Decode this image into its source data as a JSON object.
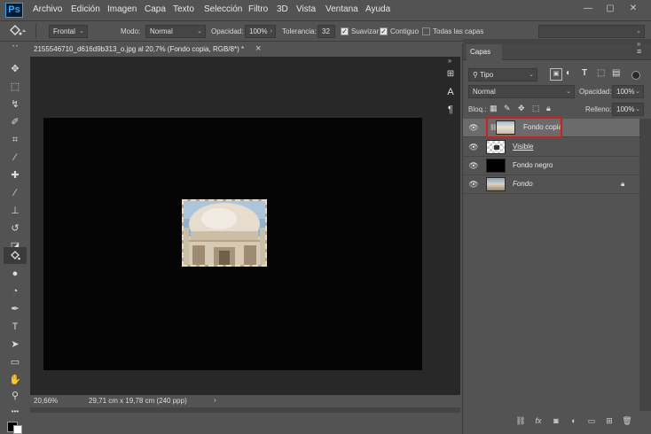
{
  "app": {
    "logo": "Ps"
  },
  "menu": [
    "Archivo",
    "Edición",
    "Imagen",
    "Capa",
    "Texto",
    "Selección",
    "Filtro",
    "3D",
    "Vista",
    "Ventana",
    "Ayuda"
  ],
  "window_controls": {
    "minimize": "—",
    "maximize": "▢",
    "close": "✕"
  },
  "options": {
    "preset": "Frontal",
    "mode_label": "Modo:",
    "mode_value": "Normal",
    "opacity_label": "Opacidad:",
    "opacity_value": "100%",
    "tolerance_label": "Tolerancia:",
    "tolerance_value": "32",
    "smooth_label": "Suavizar",
    "contiguous_label": "Contiguo",
    "all_layers_label": "Todas las capas"
  },
  "document": {
    "tab_title": "2155546710_d616d9b313_o.jpg al 20,7% (Fondo copia, RGB/8*) *",
    "close": "×",
    "zoom": "20,66%",
    "dimensions": "29,71 cm x 19,78 cm (240 ppp)"
  },
  "layers_panel": {
    "tab": "Capas",
    "filter_value": "Tipo",
    "blend_mode": "Normal",
    "opacity_label": "Opacidad:",
    "opacity_value": "100%",
    "lock_label": "Bloq.:",
    "fill_label": "Relleno:",
    "fill_value": "100%",
    "layers": [
      {
        "name": "Fondo copia"
      },
      {
        "name": "Visible"
      },
      {
        "name": "Fondo negro"
      },
      {
        "name": "Fondo"
      }
    ]
  },
  "colors": {
    "highlight": "#cc1f1f",
    "canvas": "#050505",
    "workspace": "#282828"
  }
}
